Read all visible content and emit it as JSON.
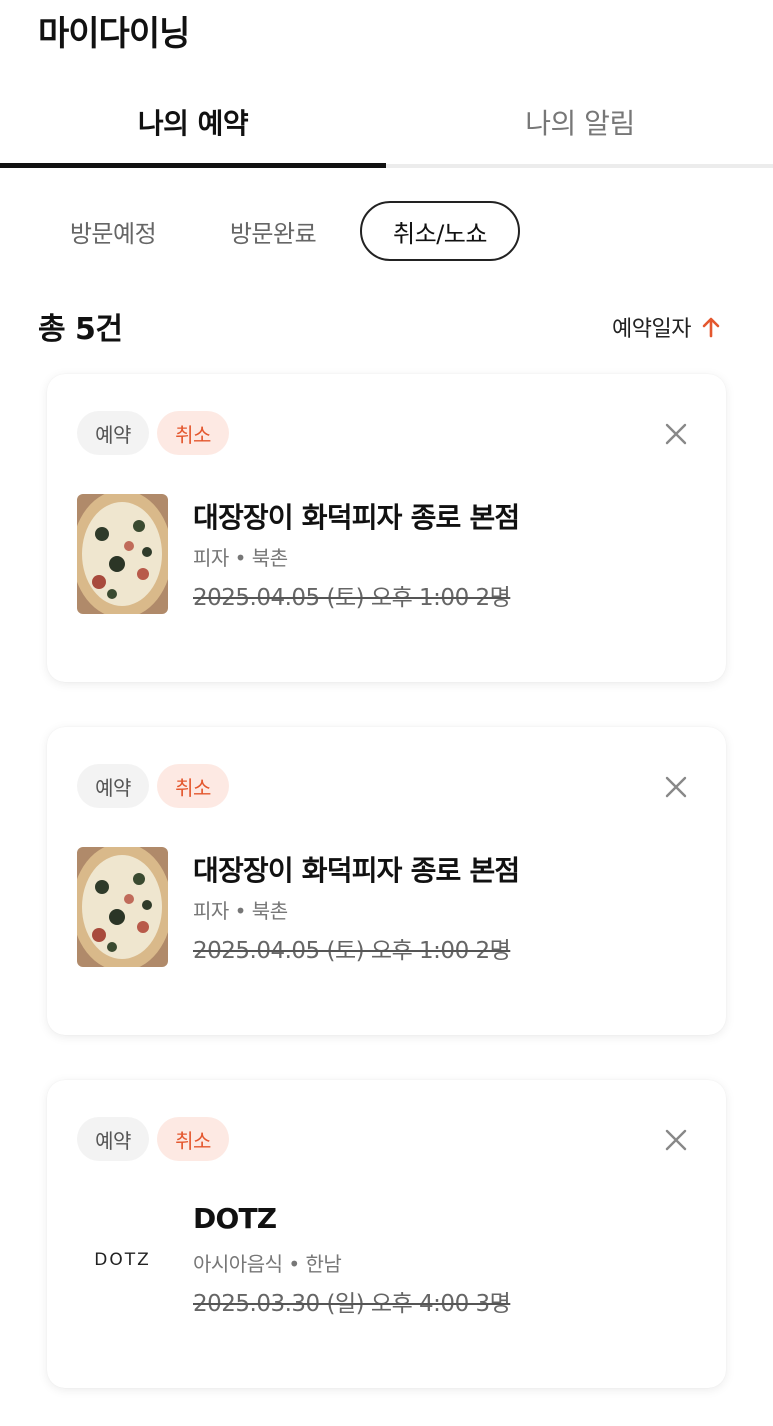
{
  "header": {
    "title": "마이다이닝"
  },
  "tabs": [
    {
      "label": "나의 예약"
    },
    {
      "label": "나의 알림"
    }
  ],
  "filters": [
    {
      "label": "방문예정"
    },
    {
      "label": "방문완료"
    },
    {
      "label": "취소/노쇼"
    }
  ],
  "summary": {
    "total": "총 5건",
    "sort_label": "예약일자",
    "sort_icon": "arrow-up-icon",
    "sort_icon_color": "#e4572e"
  },
  "colors": {
    "accent": "#e4572e",
    "status_badge_bg": "#fde9e3"
  },
  "reservations": [
    {
      "type_badge": "예약",
      "status_badge": "취소",
      "name": "대장장이 화덕피자 종로 본점",
      "meta": "피자 • 북촌",
      "datetime": "2025.04.05 (토) 오후 1:00 2명",
      "thumb": "pizza-thumbnail"
    },
    {
      "type_badge": "예약",
      "status_badge": "취소",
      "name": "대장장이 화덕피자 종로 본점",
      "meta": "피자 • 북촌",
      "datetime": "2025.04.05 (토) 오후 1:00 2명",
      "thumb": "pizza-thumbnail"
    },
    {
      "type_badge": "예약",
      "status_badge": "취소",
      "name": "DOTZ",
      "meta": "아시아음식 • 한남",
      "datetime": "2025.03.30 (일) 오후 4:00 3명",
      "logo_text": "DOTZ"
    }
  ]
}
